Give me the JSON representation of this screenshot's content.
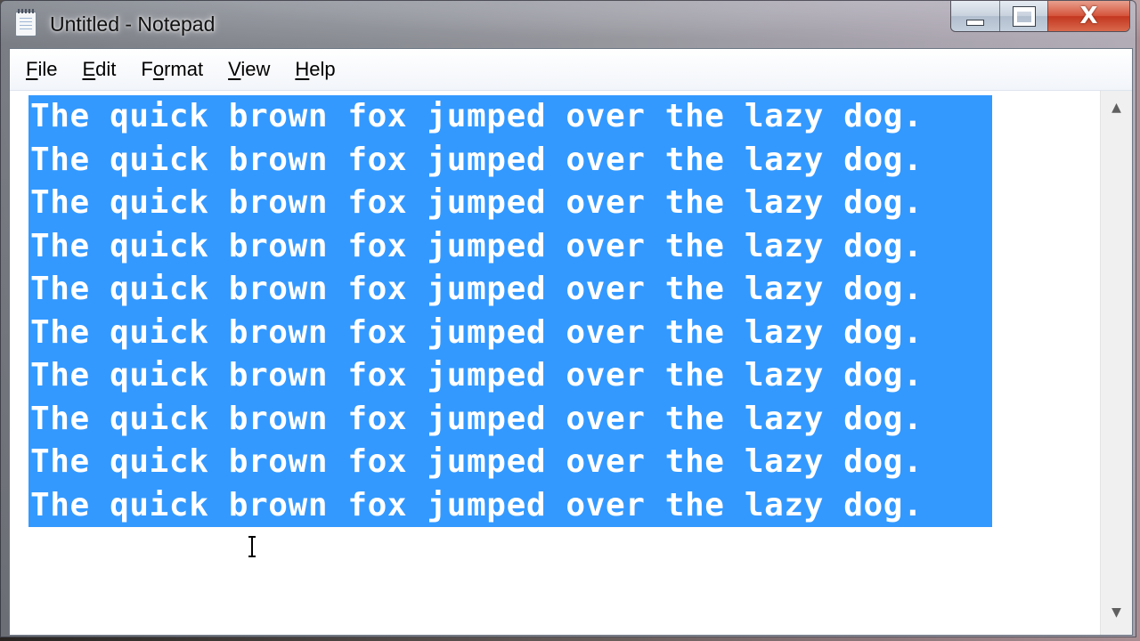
{
  "window": {
    "title": "Untitled - Notepad",
    "controls": {
      "minimize_icon": "minimize-icon",
      "maximize_icon": "maximize-icon",
      "close_icon": "close-icon",
      "close_glyph": "X"
    }
  },
  "menubar": {
    "items": [
      {
        "label": "File",
        "accel": "F",
        "rest": "ile"
      },
      {
        "label": "Edit",
        "accel": "E",
        "rest": "dit"
      },
      {
        "label": "Format",
        "pre": "F",
        "accel": "o",
        "rest": "rmat"
      },
      {
        "label": "View",
        "accel": "V",
        "rest": "iew"
      },
      {
        "label": "Help",
        "accel": "H",
        "rest": "elp"
      }
    ]
  },
  "editor": {
    "lines": [
      "The quick brown fox jumped over the lazy dog.",
      "The quick brown fox jumped over the lazy dog.",
      "The quick brown fox jumped over the lazy dog.",
      "The quick brown fox jumped over the lazy dog.",
      "The quick brown fox jumped over the lazy dog.",
      "The quick brown fox jumped over the lazy dog.",
      "The quick brown fox jumped over the lazy dog.",
      "The quick brown fox jumped over the lazy dog.",
      "The quick brown fox jumped over the lazy dog.",
      "The quick brown fox jumped over the lazy dog."
    ],
    "selection_color": "#3399ff",
    "selected_text_color": "#ffffff"
  },
  "scrollbar": {
    "up_glyph": "▲",
    "down_glyph": "▼"
  }
}
